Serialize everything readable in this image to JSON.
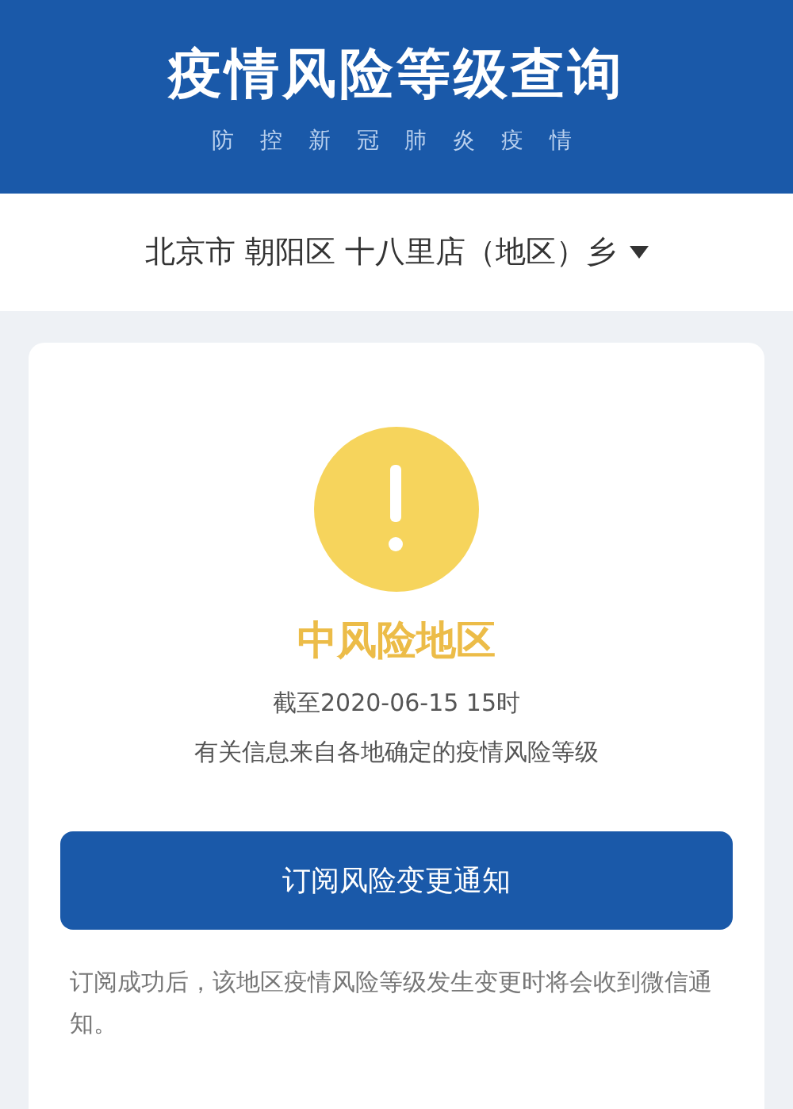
{
  "header": {
    "title": "疫情风险等级查询",
    "subtitle": "防 控 新 冠 肺 炎 疫 情"
  },
  "location": {
    "value": "北京市 朝阳区 十八里店（地区）乡"
  },
  "result": {
    "level": "中风险地区",
    "as_of": "截至2020-06-15 15时",
    "source": "有关信息来自各地确定的疫情风险等级"
  },
  "subscribe_button": "订阅风险变更通知",
  "note": "订阅成功后，该地区疫情风险等级发生变更时将会收到微信通知。"
}
